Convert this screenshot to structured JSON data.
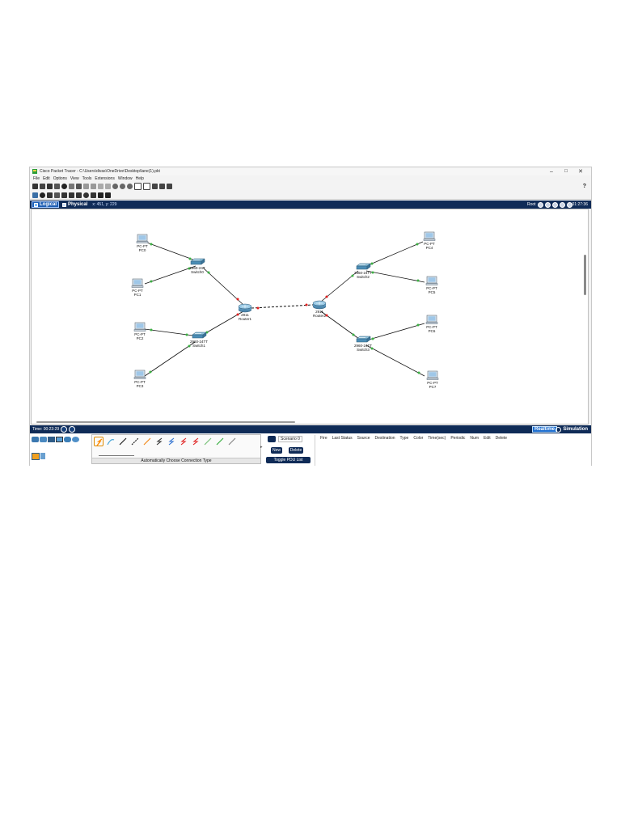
{
  "window": {
    "title": "Cisco Packet Tracer - C:\\Users\\divas\\OneDrive\\Desktop\\lane(1).pkt",
    "controls": {
      "minimize": "–",
      "maximize": "☐",
      "close": "✕"
    }
  },
  "menu": [
    "File",
    "Edit",
    "Options",
    "View",
    "Tools",
    "Extensions",
    "Window",
    "Help"
  ],
  "help_symbol": "?",
  "workspace": {
    "logical_label": "Logical",
    "physical_label": "Physical",
    "coords": "x: 451, y: 229",
    "root_label": "Root",
    "clock": "01:27:36"
  },
  "devices": [
    {
      "id": "pc0",
      "type": "pc",
      "model": "PC-PT",
      "name": "PC0"
    },
    {
      "id": "pc1",
      "type": "pc",
      "model": "PC-PT",
      "name": "PC1"
    },
    {
      "id": "pc2",
      "type": "pc",
      "model": "PC-PT",
      "name": "PC2"
    },
    {
      "id": "pc3",
      "type": "pc",
      "model": "PC-PT",
      "name": "PC3"
    },
    {
      "id": "pc4",
      "type": "pc",
      "model": "PC-PT",
      "name": "PC4"
    },
    {
      "id": "pc5",
      "type": "pc",
      "model": "PC-PT",
      "name": "PC5"
    },
    {
      "id": "pc6",
      "type": "pc",
      "model": "PC-PT",
      "name": "PC6"
    },
    {
      "id": "pc7",
      "type": "pc",
      "model": "PC-PT",
      "name": "PC7"
    },
    {
      "id": "sw0",
      "type": "switch",
      "model": "2960-24T",
      "name": "Switch0"
    },
    {
      "id": "sw1",
      "type": "switch",
      "model": "2960-24TT",
      "name": "Switch1"
    },
    {
      "id": "sw2",
      "type": "switch",
      "model": "2960-24TT",
      "name": "Switch2"
    },
    {
      "id": "sw3",
      "type": "switch",
      "model": "2960-24TT",
      "name": "Switch3"
    },
    {
      "id": "r1",
      "type": "router",
      "model": "2911",
      "name": "Router1"
    },
    {
      "id": "r2",
      "type": "router",
      "model": "2911",
      "name": "Router2"
    }
  ],
  "status_bar": {
    "time": "Time: 00:23:29",
    "realtime_label": "Realtime",
    "simulation_label": "Simulation"
  },
  "connections_panel": {
    "label": "Automatically Choose Connection Type"
  },
  "pdu_panel": {
    "scenario": "Scenario 0",
    "new_label": "New",
    "delete_label": "Delete",
    "toggle_label": "Toggle PDU List Window"
  },
  "pdu_table": {
    "columns": [
      "Fire",
      "Last Status",
      "Source",
      "Destination",
      "Type",
      "Color",
      "Time(sec)",
      "Periodic",
      "Num",
      "Edit",
      "Delete"
    ]
  },
  "colors": {
    "accent": "#0f2b57",
    "link_up": "#3cb043",
    "link_down": "#e02020"
  }
}
